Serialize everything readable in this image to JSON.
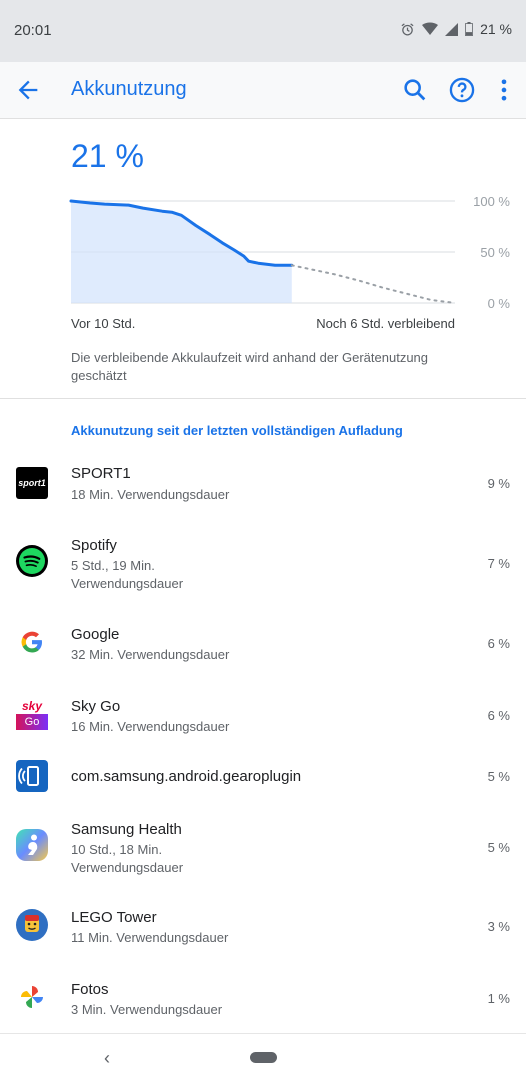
{
  "status_bar": {
    "time": "20:01",
    "battery": "21 %",
    "icons": [
      "alarm-icon",
      "wifi-icon",
      "signal-icon",
      "battery-icon"
    ]
  },
  "app_bar": {
    "title": "Akkunutzung",
    "icons": [
      "back-arrow-icon",
      "search-icon",
      "help-icon",
      "more-vert-icon"
    ],
    "accent": "#1a73e8"
  },
  "battery_level": "21 %",
  "chart_data": {
    "type": "area",
    "y_tick_labels": [
      "100 %",
      "50 %",
      "0 %"
    ],
    "x_labels": [
      "Vor 10 Std.",
      "Noch 6 Std. verbleibend"
    ],
    "ylim": [
      0,
      100
    ],
    "xlim_hours": [
      -10,
      6
    ],
    "series": [
      {
        "x": [
          -10,
          -9.2,
          -8.6,
          -7.6,
          -7,
          -6.2,
          -5.8,
          -5.4,
          -4.8,
          -4.2,
          -3.7,
          -3.2,
          -2.8,
          -2.6,
          -2.2,
          -1.5,
          -0.8
        ],
        "y": [
          100,
          98,
          97,
          96,
          93,
          90,
          89,
          86,
          76,
          67,
          59,
          52,
          46,
          41,
          39,
          37,
          37
        ]
      },
      {
        "x": [
          -0.8,
          0,
          1,
          2,
          3,
          4,
          5,
          6
        ],
        "y": [
          37,
          33,
          28,
          22,
          15,
          9,
          3,
          0
        ],
        "style": "dotted-projection"
      }
    ],
    "grid": true,
    "colors": {
      "line": "#1a73e8",
      "fill": "#d2e3fc",
      "projection": "#9aa0a6"
    }
  },
  "estimate_note": "Die verbleibende Akkulaufzeit wird anhand der Gerätenutzung geschätzt",
  "section_title": "Akkunutzung seit der letzten vollständigen Aufladung",
  "apps": [
    {
      "name": "SPORT1",
      "sub": "18 Min. Verwendungsdauer",
      "value": "9 %",
      "icon": "sport1-icon",
      "icon_text": "sport1"
    },
    {
      "name": "Spotify",
      "sub": "5 Std., 19 Min. Verwendungsdauer",
      "value": "7 %",
      "icon": "spotify-icon"
    },
    {
      "name": "Google",
      "sub": "32 Min. Verwendungsdauer",
      "value": "6 %",
      "icon": "google-icon",
      "icon_text": "G"
    },
    {
      "name": "Sky Go",
      "sub": "16 Min. Verwendungsdauer",
      "value": "6 %",
      "icon": "sky-go-icon",
      "icon_text": "sky",
      "icon_text2": "Go"
    },
    {
      "name": "com.samsung.android.gearoplugin",
      "sub": "",
      "value": "5 %",
      "icon": "gear-plugin-icon"
    },
    {
      "name": "Samsung Health",
      "sub": "10 Std., 18 Min. Verwendungsdauer",
      "value": "5 %",
      "icon": "samsung-health-icon"
    },
    {
      "name": "LEGO Tower",
      "sub": "11 Min. Verwendungsdauer",
      "value": "3 %",
      "icon": "lego-tower-icon"
    },
    {
      "name": "Fotos",
      "sub": "3 Min. Verwendungsdauer",
      "value": "1 %",
      "icon": "photos-icon"
    }
  ],
  "nav_bar": {
    "back_glyph": "‹"
  }
}
